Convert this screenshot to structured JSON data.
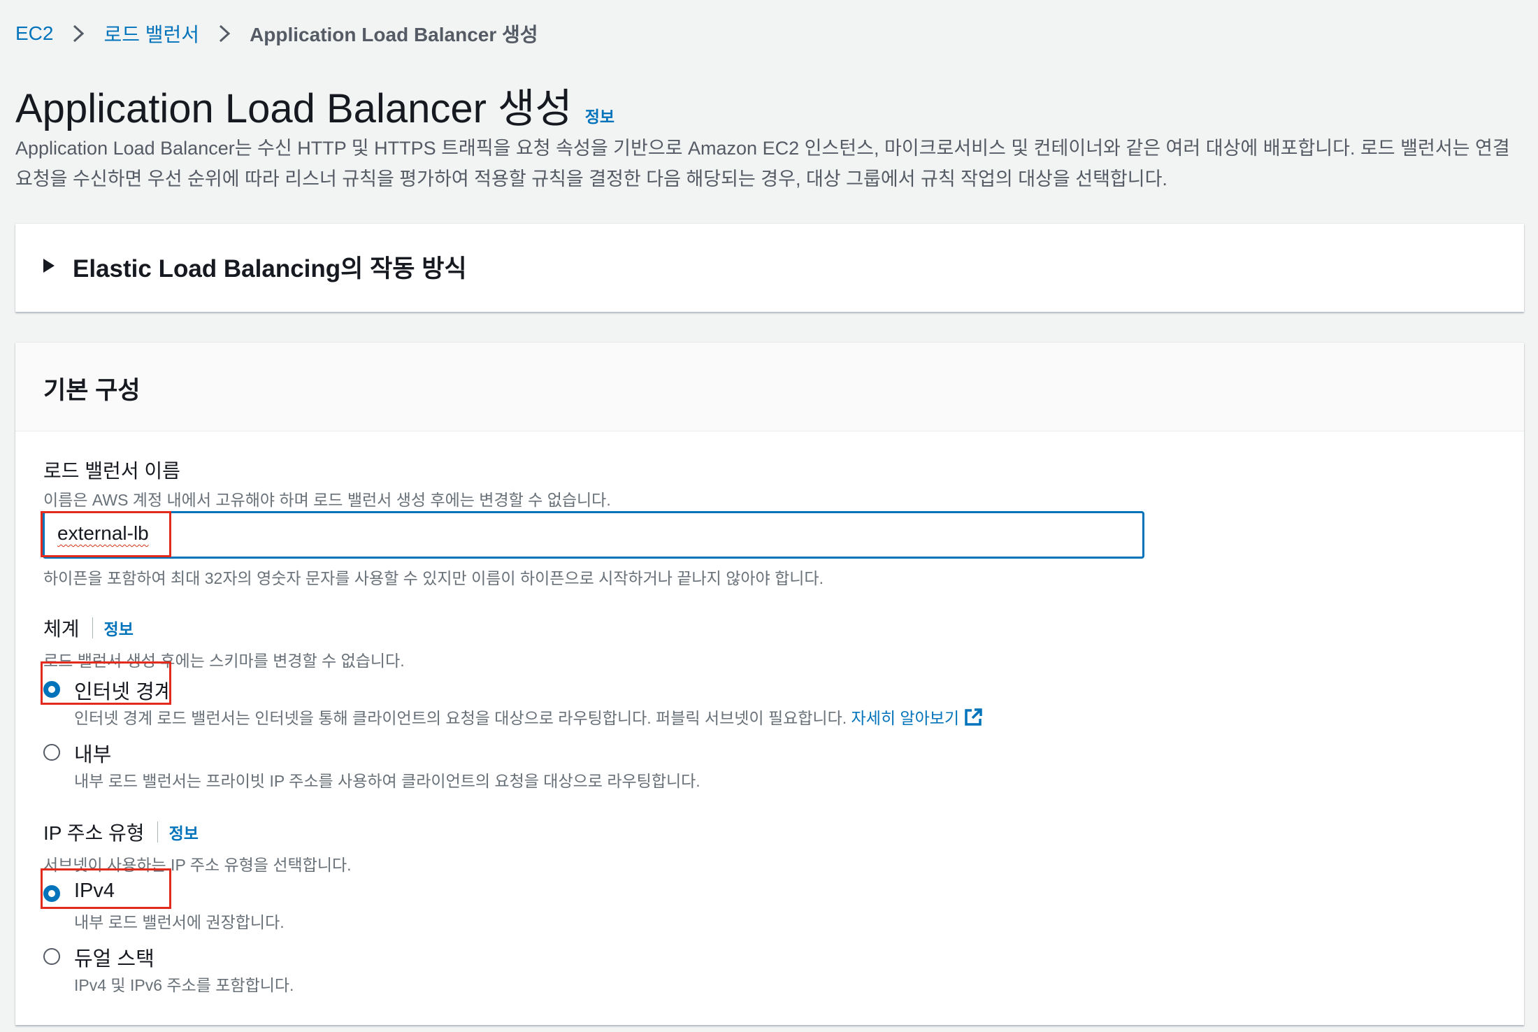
{
  "breadcrumb": {
    "items": [
      "EC2",
      "로드 밸런서"
    ],
    "current": "Application Load Balancer 생성"
  },
  "header": {
    "title": "Application Load Balancer 생성",
    "info_link": "정보",
    "description": "Application Load Balancer는 수신 HTTP 및 HTTPS 트래픽을 요청 속성을 기반으로 Amazon EC2 인스턴스, 마이크로서비스 및 컨테이너와 같은 여러 대상에 배포합니다. 로드 밸런서는 연결 요청을 수신하면 우선 순위에 따라 리스너 규칙을 평가하여 적용할 규칙을 결정한 다음 해당되는 경우, 대상 그룹에서 규칙 작업의 대상을 선택합니다."
  },
  "how_it_works": {
    "title": "Elastic Load Balancing의 작동 방식"
  },
  "basic_config": {
    "title": "기본 구성",
    "name_field": {
      "label": "로드 밸런서 이름",
      "hint": "이름은 AWS 계정 내에서 고유해야 하며 로드 밸런서 생성 후에는 변경할 수 없습니다.",
      "value": "external-lb",
      "constraint": "하이픈을 포함하여 최대 32자의 영숫자 문자를 사용할 수 있지만 이름이 하이픈으로 시작하거나 끝나지 않아야 합니다."
    },
    "scheme": {
      "label": "체계",
      "info_link": "정보",
      "hint": "로드 밸런서 생성 후에는 스키마를 변경할 수 없습니다.",
      "options": [
        {
          "label": "인터넷 경계",
          "description": "인터넷 경계 로드 밸런서는 인터넷을 통해 클라이언트의 요청을 대상으로 라우팅합니다. 퍼블릭 서브넷이 필요합니다.",
          "link": "자세히 알아보기",
          "selected": true
        },
        {
          "label": "내부",
          "description": "내부 로드 밸런서는 프라이빗 IP 주소를 사용하여 클라이언트의 요청을 대상으로 라우팅합니다.",
          "selected": false
        }
      ]
    },
    "ip_type": {
      "label": "IP 주소 유형",
      "info_link": "정보",
      "hint": "서브넷이 사용하는 IP 주소 유형을 선택합니다.",
      "options": [
        {
          "label": "IPv4",
          "description": "내부 로드 밸런서에 권장합니다.",
          "selected": true
        },
        {
          "label": "듀얼 스택",
          "description": "IPv4 및 IPv6 주소를 포함합니다.",
          "selected": false
        }
      ]
    }
  },
  "colors": {
    "link": "#0073bb",
    "highlight": "#e22b1c",
    "background": "#f2f3f3"
  }
}
